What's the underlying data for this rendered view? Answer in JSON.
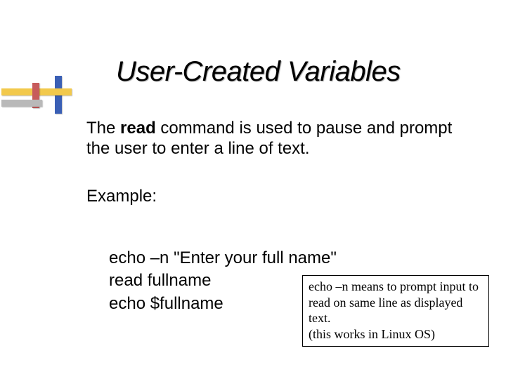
{
  "title": "User-Created Variables",
  "intro": {
    "pre": "The ",
    "bold": "read",
    "post": " command is used to pause and prompt the user to enter a line of text."
  },
  "example_label": "Example:",
  "code": {
    "l1": "echo –n \"Enter your full name\"",
    "l2": "read fullname",
    "l3": "echo $fullname"
  },
  "note": {
    "l1a": "echo –n",
    "l1b": " means to prompt input to read on same line as displayed text.",
    "l2": "(this works in Linux OS)"
  }
}
